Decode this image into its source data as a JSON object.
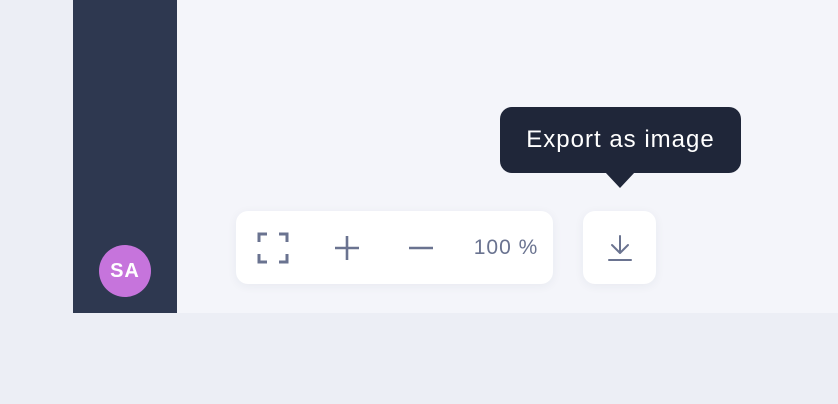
{
  "sidebar": {
    "avatar_initials": "SA",
    "avatar_color": "#c674dc",
    "background": "#2e3850"
  },
  "toolbar": {
    "fit_icon": "fullscreen-icon",
    "zoom_in_icon": "plus-icon",
    "zoom_out_icon": "minus-icon",
    "zoom_level": "100 %"
  },
  "export": {
    "icon": "download-icon",
    "tooltip": "Export as image"
  }
}
